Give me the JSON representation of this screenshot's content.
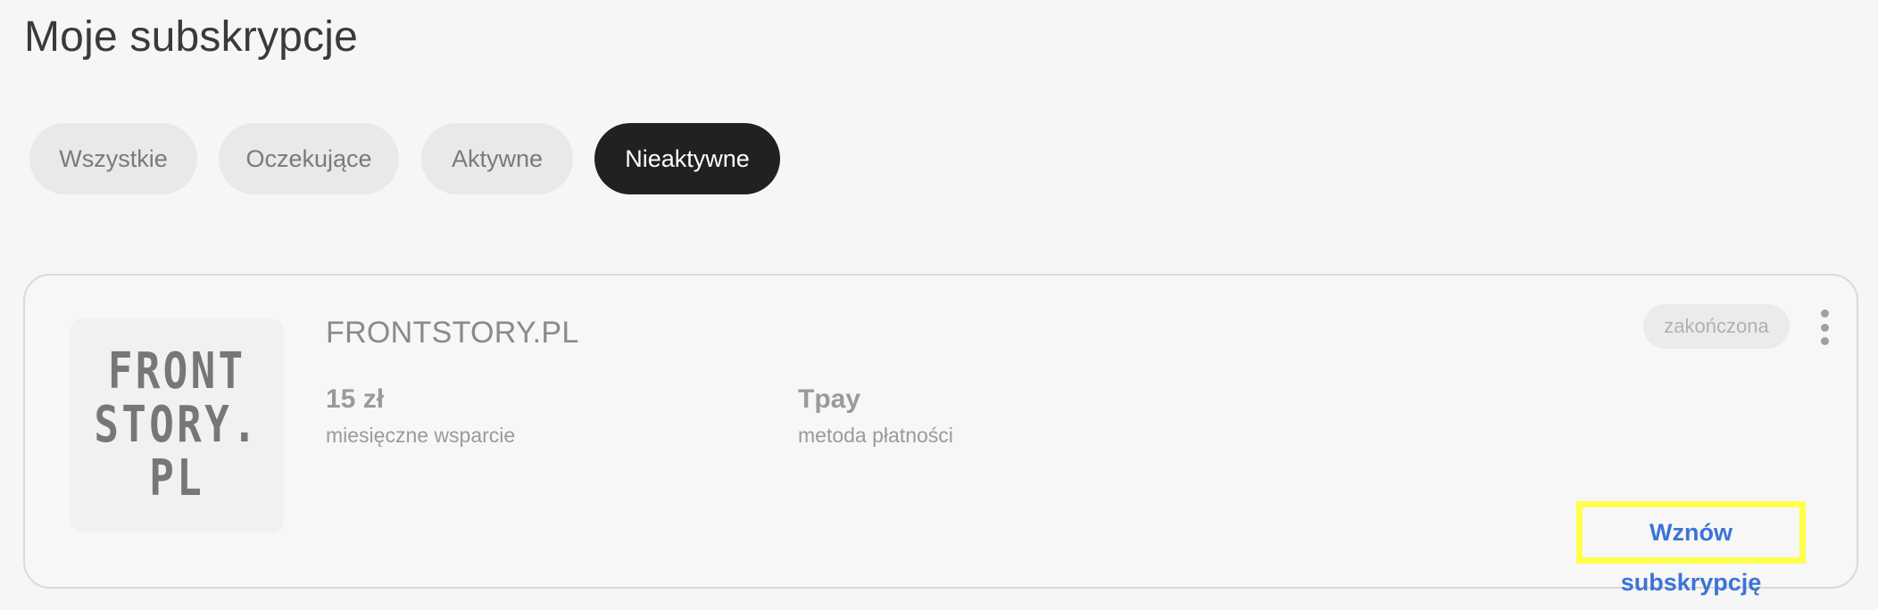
{
  "page": {
    "title": "Moje subskrypcje"
  },
  "filters": {
    "tabs": [
      {
        "label": "Wszystkie",
        "active": false
      },
      {
        "label": "Oczekujące",
        "active": false
      },
      {
        "label": "Aktywne",
        "active": false
      },
      {
        "label": "Nieaktywne",
        "active": true
      }
    ]
  },
  "subscription": {
    "logo_text": "FRONT\nSTORY.\nPL",
    "name": "FRONTSTORY.PL",
    "amount": "15 zł",
    "amount_label": "miesięczne wsparcie",
    "payment_method": "Tpay",
    "payment_method_label": "metoda płatności",
    "status": "zakończona",
    "resume_label": "Wznów subskrypcję",
    "menu_icon": "more-vertical-icon"
  },
  "colors": {
    "background": "#f6f6f6",
    "active_tab": "#212121",
    "inactive_tab": "#e9e9e9",
    "link": "#3c74d6",
    "highlight": "#ffff4d"
  }
}
